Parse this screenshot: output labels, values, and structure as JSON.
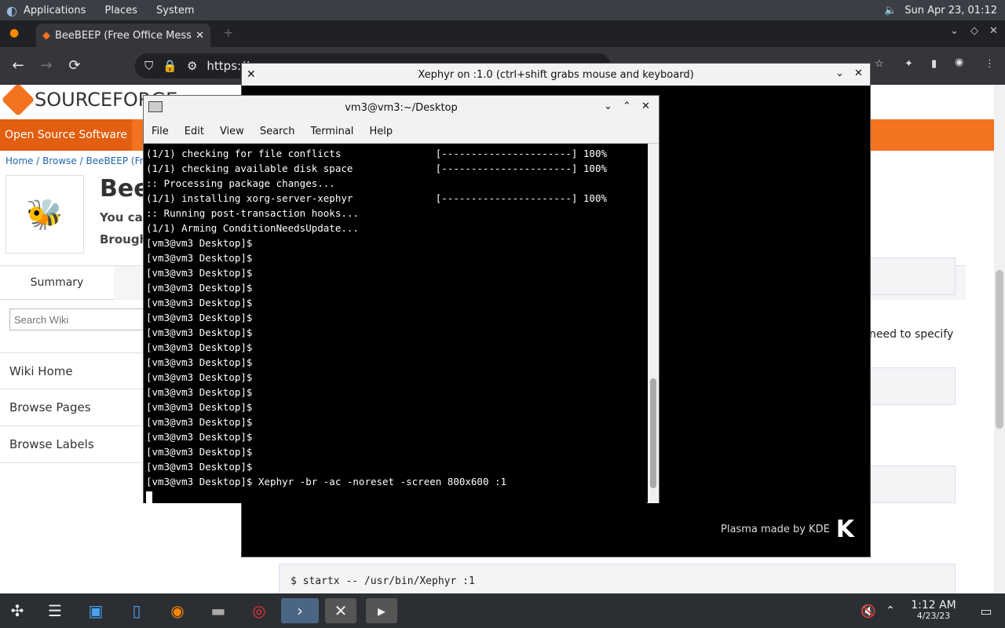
{
  "top_panel": {
    "menus": [
      "Applications",
      "Places",
      "System"
    ],
    "datetime": "Sun Apr 23, 01:12"
  },
  "browser": {
    "tab_title": "BeeBEEP (Free Office Mess",
    "url": "https://",
    "page": {
      "logo_text": "SOURCEFORGE",
      "nav_oss": "Open Source Software",
      "breadcrumb": "Home / Browse / BeeBEEP (Free",
      "project_title": "Bee",
      "desc1": "You can",
      "desc2": "Brough",
      "summary_tab": "Summary",
      "search_placeholder": "Search Wiki",
      "wiki_links": [
        "Wiki Home",
        "Browse Pages",
        "Browse Labels"
      ],
      "bg_text": "need to specify",
      "code_line": "$ startx -- /usr/bin/Xephyr :1"
    }
  },
  "xephyr": {
    "title": "Xephyr on :1.0 (ctrl+shift grabs mouse and keyboard)",
    "brand": "Plasma made by KDE"
  },
  "terminal": {
    "title": "vm3@vm3:~/Desktop",
    "menu": [
      "File",
      "Edit",
      "View",
      "Search",
      "Terminal",
      "Help"
    ],
    "lines": [
      "(1/1) checking for file conflicts                [----------------------] 100%",
      "(1/1) checking available disk space              [----------------------] 100%",
      ":: Processing package changes...",
      "(1/1) installing xorg-server-xephyr              [----------------------] 100%",
      ":: Running post-transaction hooks...",
      "(1/1) Arming ConditionNeedsUpdate...",
      "[vm3@vm3 Desktop]$",
      "[vm3@vm3 Desktop]$",
      "[vm3@vm3 Desktop]$",
      "[vm3@vm3 Desktop]$",
      "[vm3@vm3 Desktop]$",
      "[vm3@vm3 Desktop]$",
      "[vm3@vm3 Desktop]$",
      "[vm3@vm3 Desktop]$",
      "[vm3@vm3 Desktop]$",
      "[vm3@vm3 Desktop]$",
      "[vm3@vm3 Desktop]$",
      "[vm3@vm3 Desktop]$",
      "[vm3@vm3 Desktop]$",
      "[vm3@vm3 Desktop]$",
      "[vm3@vm3 Desktop]$",
      "[vm3@vm3 Desktop]$",
      "[vm3@vm3 Desktop]$ Xephyr -br -ac -noreset -screen 800x600 :1"
    ]
  },
  "taskbar": {
    "time": "1:12 AM",
    "date": "4/23/23"
  }
}
